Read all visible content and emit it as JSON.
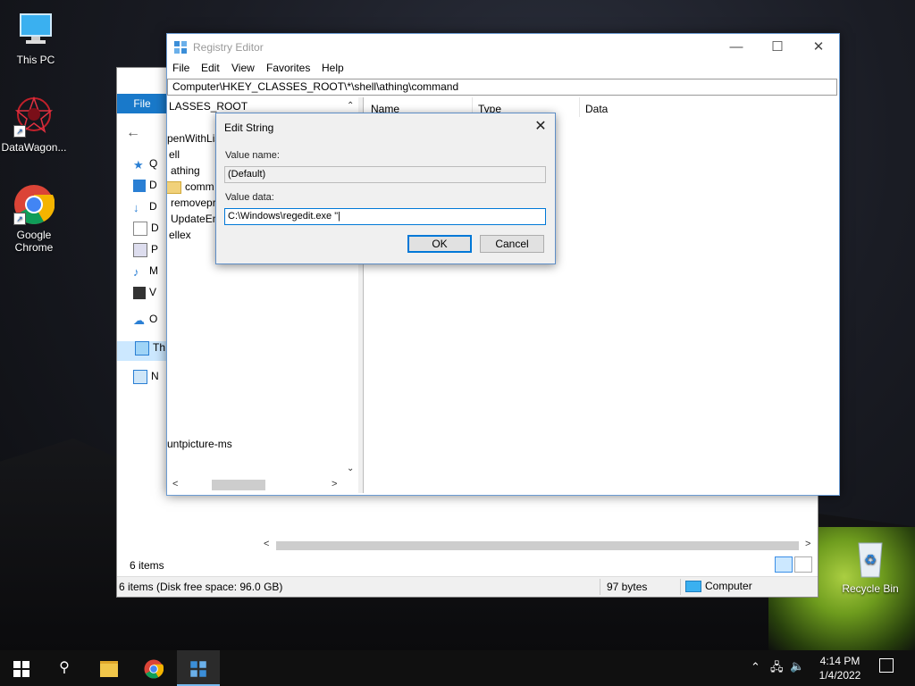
{
  "desktop": {
    "icons": [
      {
        "label": "This PC"
      },
      {
        "label": "DataWagon..."
      },
      {
        "label": "Google Chrome"
      },
      {
        "label": "Recycle Bin"
      }
    ]
  },
  "explorer": {
    "file_tab": "File",
    "sidebar_items": [
      "Q",
      "D",
      "D",
      "D",
      "P",
      "M",
      "V",
      "O",
      "Th",
      "N"
    ],
    "item_count": "6 items",
    "status": {
      "left": "6 items (Disk free space: 96.0 GB)",
      "size": "97 bytes",
      "location": "Computer"
    }
  },
  "regedit": {
    "title": "Registry Editor",
    "menu": [
      "File",
      "Edit",
      "View",
      "Favorites",
      "Help"
    ],
    "address": "Computer\\HKEY_CLASSES_ROOT\\*\\shell\\athing\\command",
    "tree": {
      "root": "LASSES_ROOT",
      "items": [
        "penWithLis",
        "ell",
        "athing",
        "comm",
        "removepr",
        "UpdateEn",
        "ellex",
        "untpicture-ms"
      ]
    },
    "columns": [
      "Name",
      "Type",
      "Data"
    ]
  },
  "dialog": {
    "title": "Edit String",
    "value_name_label": "Value name:",
    "value_name": "(Default)",
    "value_data_label": "Value data:",
    "value_data": "C:\\Windows\\regedit.exe \"|",
    "ok": "OK",
    "cancel": "Cancel"
  },
  "taskbar": {
    "time": "4:14 PM",
    "date": "1/4/2022"
  },
  "colors": {
    "accent": "#0078d7",
    "file_tab": "#1979ca",
    "folder": "#f1d17a"
  }
}
